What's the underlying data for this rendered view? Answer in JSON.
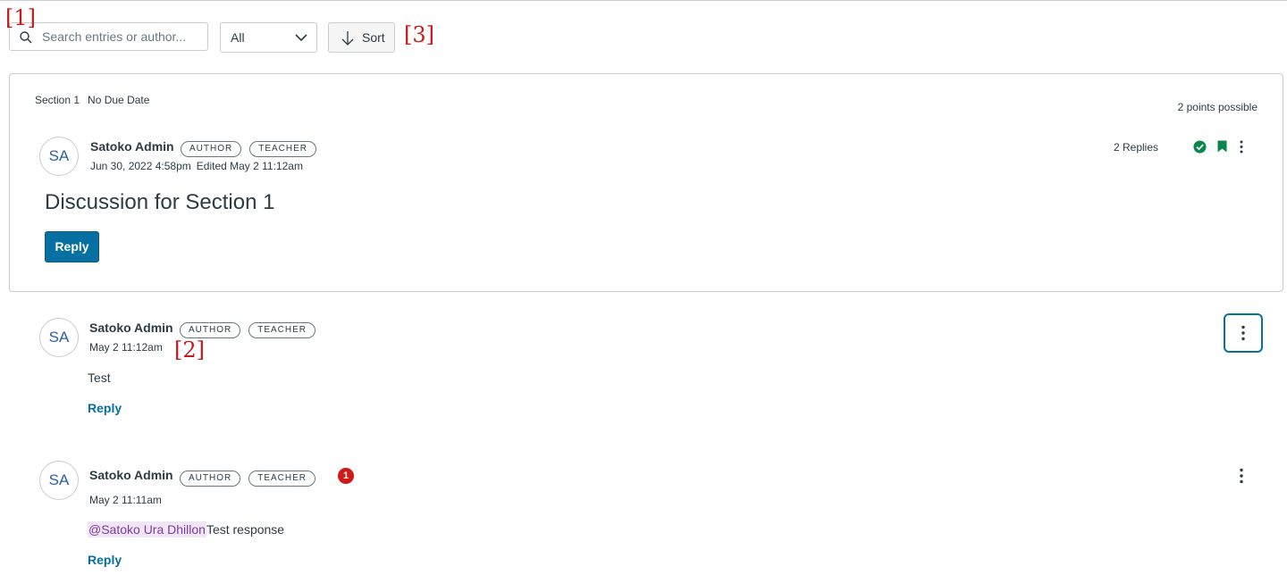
{
  "annotations": {
    "a1": "[1]",
    "a2": "[2]",
    "a3": "[3]"
  },
  "toolbar": {
    "search": {
      "placeholder": "Search entries or author...",
      "value": "",
      "icon": "search-icon"
    },
    "filter": {
      "selected": "All",
      "icon": "chevron-down-icon"
    },
    "sort": {
      "label": "Sort",
      "icon": "arrow-down-icon"
    }
  },
  "topic": {
    "section": "Section 1",
    "due": "No Due Date",
    "points": "2 points possible",
    "author": {
      "initials": "SA",
      "name": "Satoko Admin",
      "roles": [
        "AUTHOR",
        "TEACHER"
      ],
      "posted": "Jun 30, 2022 4:58pm",
      "edited": "Edited May 2 11:12am"
    },
    "replies": "2 Replies",
    "title": "Discussion for Section 1",
    "reply_label": "Reply",
    "icons": {
      "published": "check-circle-icon",
      "bookmark": "bookmark-icon",
      "options": "kebab-icon"
    }
  },
  "entries": [
    {
      "initials": "SA",
      "name": "Satoko Admin",
      "roles": [
        "AUTHOR",
        "TEACHER"
      ],
      "date": "May 2 11:12am",
      "message": "Test",
      "reply_label": "Reply"
    },
    {
      "initials": "SA",
      "name": "Satoko Admin",
      "roles": [
        "AUTHOR",
        "TEACHER"
      ],
      "unread_count": "1",
      "date": "May 2 11:11am",
      "mention": "@Satoko Ura Dhillon",
      "message": "Test response",
      "reply_label": "Reply"
    }
  ],
  "colors": {
    "primary": "#0770a3",
    "success": "#0b874b",
    "danger": "#d01a19",
    "mention_bg": "#f1e6f5",
    "annotation": "#c8191d"
  }
}
